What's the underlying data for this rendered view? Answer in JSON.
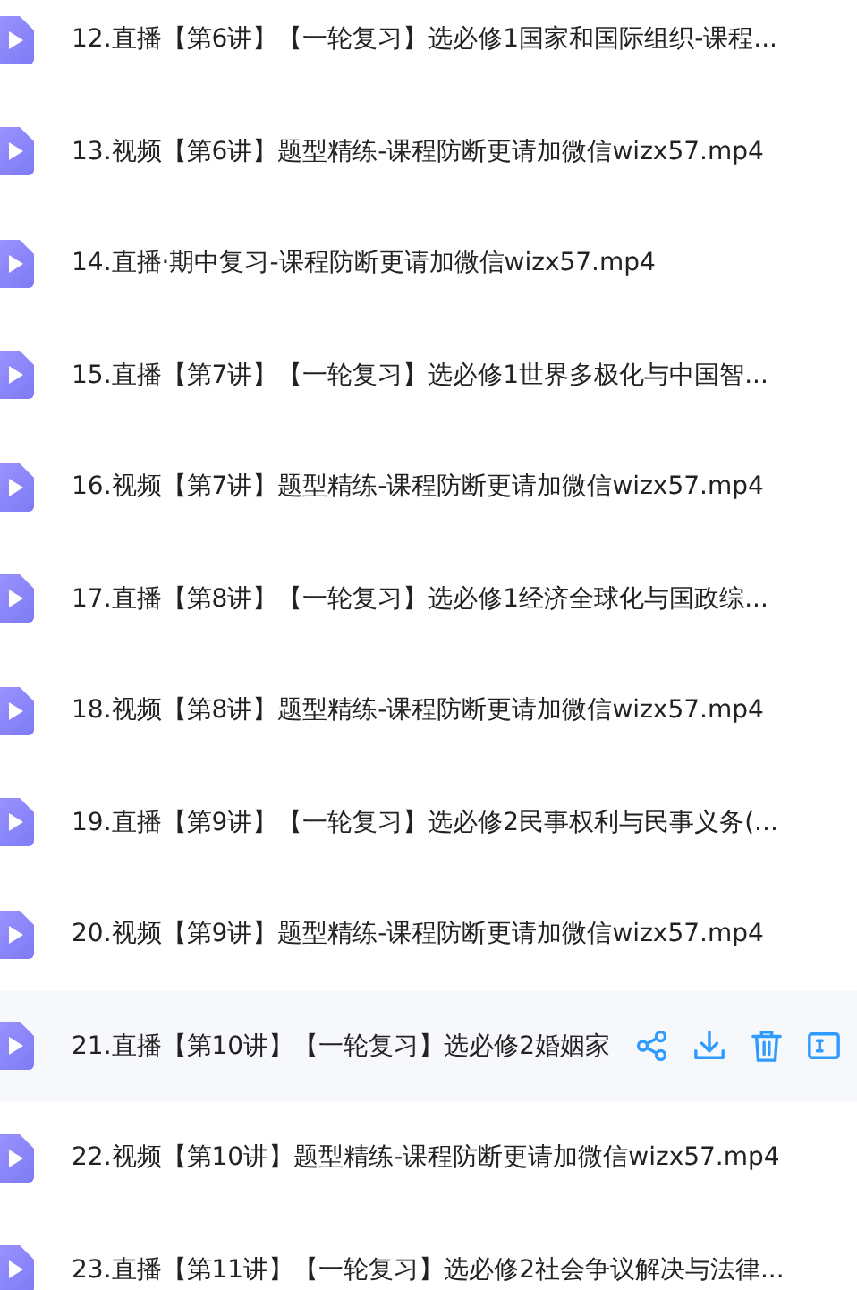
{
  "files": [
    {
      "name": "12.直播【第6讲】【一轮复习】选必修1国家和国际组织-课程...",
      "hovered": false
    },
    {
      "name": "13.视频【第6讲】题型精练-课程防断更请加微信wizx57.mp4",
      "hovered": false
    },
    {
      "name": "14.直播·期中复习-课程防断更请加微信wizx57.mp4",
      "hovered": false
    },
    {
      "name": "15.直播【第7讲】【一轮复习】选必修1世界多极化与中国智...",
      "hovered": false
    },
    {
      "name": "16.视频【第7讲】题型精练-课程防断更请加微信wizx57.mp4",
      "hovered": false
    },
    {
      "name": "17.直播【第8讲】【一轮复习】选必修1经济全球化与国政综...",
      "hovered": false
    },
    {
      "name": "18.视频【第8讲】题型精练-课程防断更请加微信wizx57.mp4",
      "hovered": false
    },
    {
      "name": "19.直播【第9讲】【一轮复习】选必修2民事权利与民事义务(...",
      "hovered": false
    },
    {
      "name": "20.视频【第9讲】题型精练-课程防断更请加微信wizx57.mp4",
      "hovered": false
    },
    {
      "name": "21.直播【第10讲】【一轮复习】选必修2婚姻家",
      "hovered": true
    },
    {
      "name": "22.视频【第10讲】题型精练-课程防断更请加微信wizx57.mp4",
      "hovered": false
    },
    {
      "name": "23.直播【第11讲】【一轮复习】选必修2社会争议解决与法律...",
      "hovered": false
    }
  ]
}
